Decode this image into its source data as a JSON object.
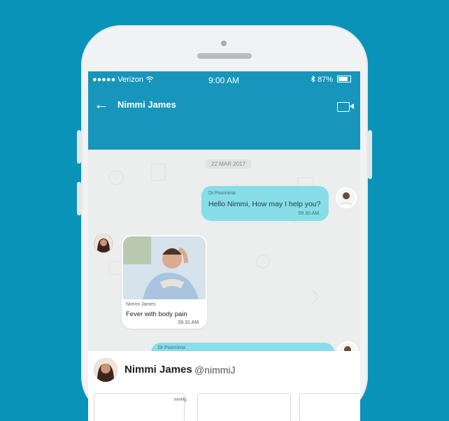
{
  "status_bar": {
    "carrier": "●●●●● Verizon",
    "time": "9:00 AM",
    "battery": "87%"
  },
  "header": {
    "back_label": "←",
    "title": "Nimmi James"
  },
  "chat": {
    "date": "22 MAR 2017",
    "messages": [
      {
        "sender": "Dr.Poornima",
        "text": "Hello Nimmi, How may I help you?",
        "time": "09.30 AM."
      },
      {
        "sender": "Nimmi James",
        "text": "Fever with body pain",
        "time": "09.31 AM."
      },
      {
        "sender": "Dr.Poornima",
        "text": "",
        "time": ""
      }
    ]
  },
  "profile": {
    "name": "Nimmi James",
    "handle": "@nimmiJ",
    "unit": "mmHg"
  },
  "colors": {
    "background": "#0a93b8",
    "header": "#1795bb",
    "bubble_out": "#87dde8"
  },
  "icons": [
    "wifi-icon",
    "bluetooth-icon",
    "battery-icon",
    "back-arrow-icon",
    "video-call-icon"
  ]
}
